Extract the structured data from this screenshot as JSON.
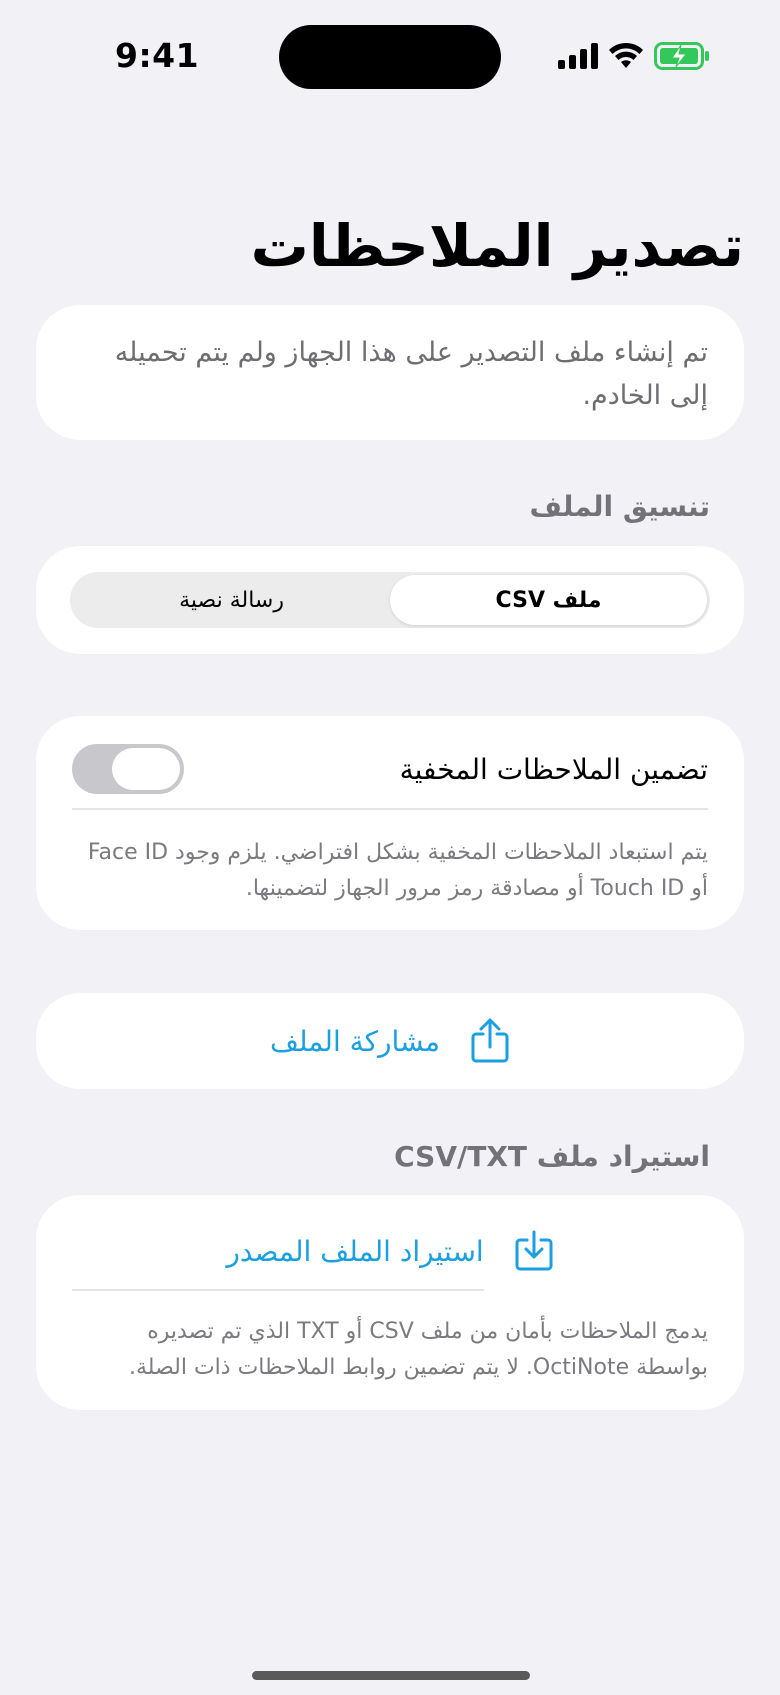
{
  "status": {
    "time": "9:41",
    "icons": [
      "signal-icon",
      "wifi-icon",
      "battery-charging-icon"
    ],
    "battery_color": "#34c759"
  },
  "page": {
    "title": "تصدير الملاحظات",
    "info_text": "تم إنشاء ملف التصدير على هذا الجهاز ولم يتم تحميله إلى الخادم."
  },
  "format": {
    "label": "تنسيق الملف",
    "options": [
      "ملف CSV",
      "رسالة نصية"
    ],
    "selected": "ملف CSV"
  },
  "hidden_notes": {
    "label": "تضمين الملاحظات المخفية",
    "enabled": false,
    "note": "يتم استبعاد الملاحظات المخفية بشكل افتراضي. يلزم وجود Face ID أو Touch ID أو مصادقة رمز مرور الجهاز لتضمينها."
  },
  "share": {
    "label": "مشاركة الملف",
    "icon": "share-icon"
  },
  "import": {
    "section_label": "استيراد ملف CSV/TXT",
    "button_label": "استيراد الملف المصدر",
    "icon": "import-icon",
    "note": "يدمج الملاحظات بأمان من ملف CSV أو TXT الذي تم تصديره بواسطة OctiNote. لا يتم تضمين روابط الملاحظات ذات الصلة."
  },
  "accent_color": "#1a9fe0"
}
